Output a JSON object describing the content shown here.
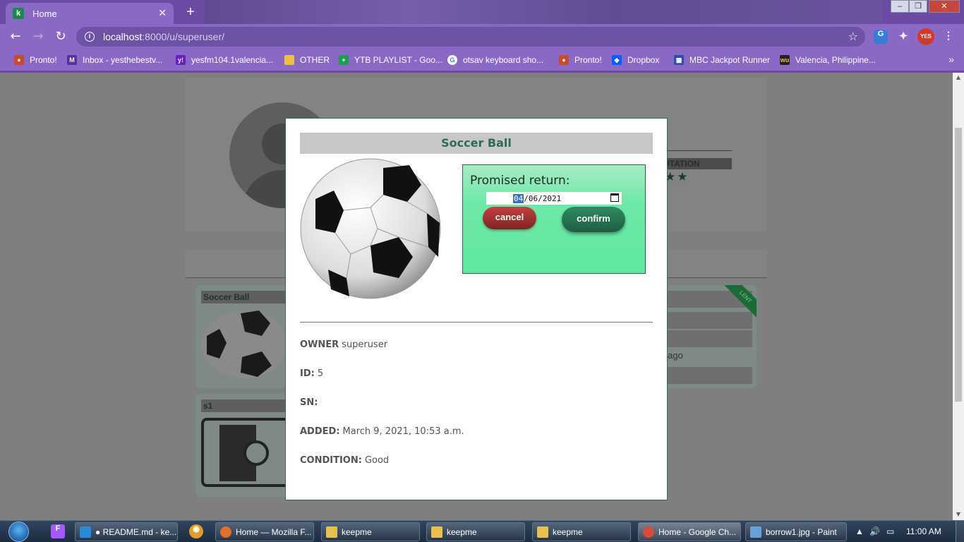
{
  "browser": {
    "tab_title": "Home",
    "tab_favicon": "k",
    "url_host": "localhost",
    "url_path": ":8000/u/superuser/",
    "bookmarks": [
      "Pronto!",
      "Inbox - yesthebestv...",
      "yesfm104.1valencia...",
      "OTHER",
      "YTB PLAYLIST - Goo...",
      "otsav keyboard sho...",
      "Pronto!",
      "Dropbox",
      "MBC Jackpot Runner",
      "Valencia, Philippine..."
    ]
  },
  "background": {
    "reputation_label": "UTATION",
    "stars": "★★",
    "card1_title": "Soccer Ball",
    "card2_title": "s1",
    "ribbon_text": "LENT",
    "time_ago": "s ago"
  },
  "modal": {
    "title": "Soccer Ball",
    "borrow_label": "Promised return:",
    "date_month": "04",
    "date_rest": "/06/2021",
    "cancel_label": "cancel",
    "confirm_label": "confirm",
    "details": [
      {
        "label": "OWNER",
        "value": "superuser"
      },
      {
        "label": "ID:",
        "value": "5"
      },
      {
        "label": "SN:",
        "value": ""
      },
      {
        "label": "ADDED:",
        "value": "March 9, 2021, 10:53 a.m."
      },
      {
        "label": "CONDITION:",
        "value": "Good"
      }
    ]
  },
  "taskbar": {
    "buttons": [
      "● README.md - ke...",
      "Home — Mozilla F...",
      "keepme",
      "keepme",
      "keepme",
      "Home - Google Ch...",
      "borrow1.jpg - Paint"
    ],
    "clock": "11:00 AM"
  },
  "colors": {
    "accent_green": "#2f6b52",
    "chrome_purple": "#8a69c6",
    "cancel_red": "#a83434",
    "borrow_bg": "#5fe8a0"
  }
}
